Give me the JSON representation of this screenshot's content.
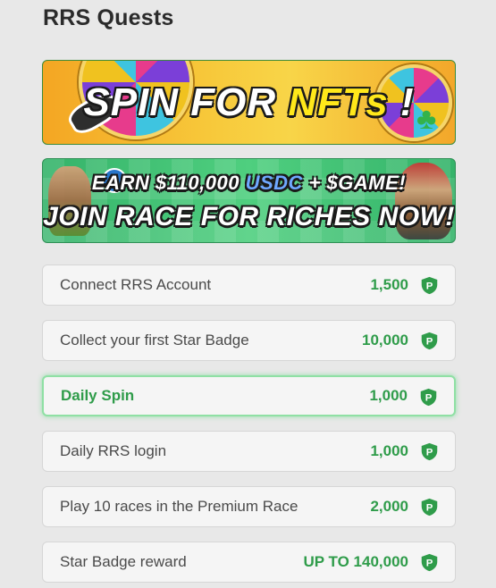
{
  "page": {
    "title": "RRS Quests"
  },
  "banners": {
    "spin": {
      "text_main": "SPIN FOR ",
      "text_accent": "NFTs",
      "text_end": " !"
    },
    "race": {
      "line1_a": "EARN $110,000 ",
      "line1_usdc": "USDC",
      "line1_b": " + $GAME!",
      "line2": "JOIN RACE FOR RICHES NOW!"
    }
  },
  "quests": [
    {
      "label": "Connect RRS Account",
      "points": "1,500",
      "active": false
    },
    {
      "label": "Collect your first Star Badge",
      "points": "10,000",
      "active": false
    },
    {
      "label": "Daily Spin",
      "points": "1,000",
      "active": true
    },
    {
      "label": "Daily RRS login",
      "points": "1,000",
      "active": false
    },
    {
      "label": "Play 10 races in the Premium Race",
      "points": "2,000",
      "active": false
    },
    {
      "label": "Star Badge reward",
      "points": "UP TO 140,000",
      "active": false
    }
  ],
  "icons": {
    "points": "points-badge-icon",
    "points_glyph": "P"
  },
  "colors": {
    "accent_green": "#2f9c4a",
    "active_border": "#8fe0a4",
    "spin_banner_yellow": "#f7c83a",
    "race_banner_green": "#4fcf7f"
  }
}
